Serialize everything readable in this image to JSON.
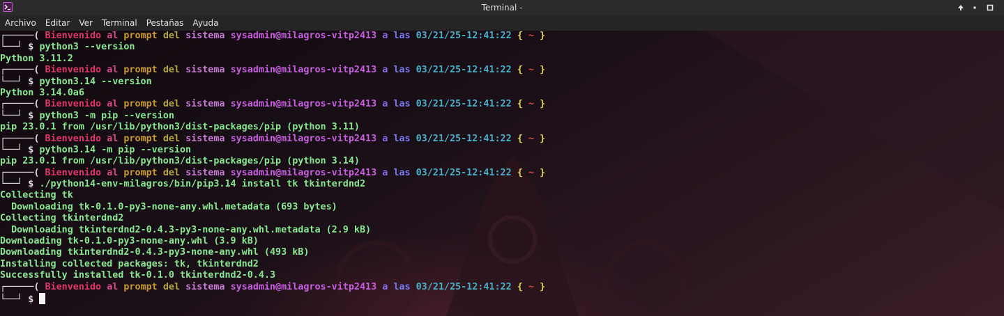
{
  "window": {
    "title": "Terminal -",
    "icon": "terminal-app-icon",
    "controls": [
      "maximize-up-icon",
      "minimize-icon",
      "close-icon"
    ]
  },
  "menu": [
    "Archivo",
    "Editar",
    "Ver",
    "Terminal",
    "Pestañas",
    "Ayuda"
  ],
  "prompt": {
    "box_top": "┌─────(",
    "box_bottom": "└──┘ $",
    "words": [
      "Bienvenido",
      "al",
      "prompt",
      "del",
      "sistema"
    ],
    "user_host": "sysadmin@milagros-vitp2413",
    "a": "a",
    "las": "las",
    "timestamp": "03/21/25-12:41:22",
    "open_brace": "{",
    "dir": "~",
    "close_brace": "}"
  },
  "session": [
    {
      "command": "python3 --version",
      "output": [
        "Python 3.11.2"
      ]
    },
    {
      "command": "python3.14 --version",
      "output": [
        "Python 3.14.0a6"
      ]
    },
    {
      "command": "python3 -m pip --version",
      "output": [
        "pip 23.0.1 from /usr/lib/python3/dist-packages/pip (python 3.11)"
      ]
    },
    {
      "command": "python3.14 -m pip --version",
      "output": [
        "pip 23.0.1 from /usr/lib/python3/dist-packages/pip (python 3.14)"
      ]
    },
    {
      "command": "./python14-env-milagros/bin/pip3.14 install tk tkinterdnd2",
      "output": [
        "Collecting tk",
        "  Downloading tk-0.1.0-py3-none-any.whl.metadata (693 bytes)",
        "Collecting tkinterdnd2",
        "  Downloading tkinterdnd2-0.4.3-py3-none-any.whl.metadata (2.9 kB)",
        "Downloading tk-0.1.0-py3-none-any.whl (3.9 kB)",
        "Downloading tkinterdnd2-0.4.3-py3-none-any.whl (493 kB)",
        "Installing collected packages: tk, tkinterdnd2",
        "Successfully installed tk-0.1.0 tkinterdnd2-0.4.3"
      ]
    },
    {
      "command": "",
      "output": [],
      "active": true
    }
  ],
  "colors": {
    "output_green": "#88e890",
    "timestamp_cyan": "#4ab0c8",
    "brace_yellow": "#e6d44a",
    "tilde_red": "#e24a3c"
  }
}
